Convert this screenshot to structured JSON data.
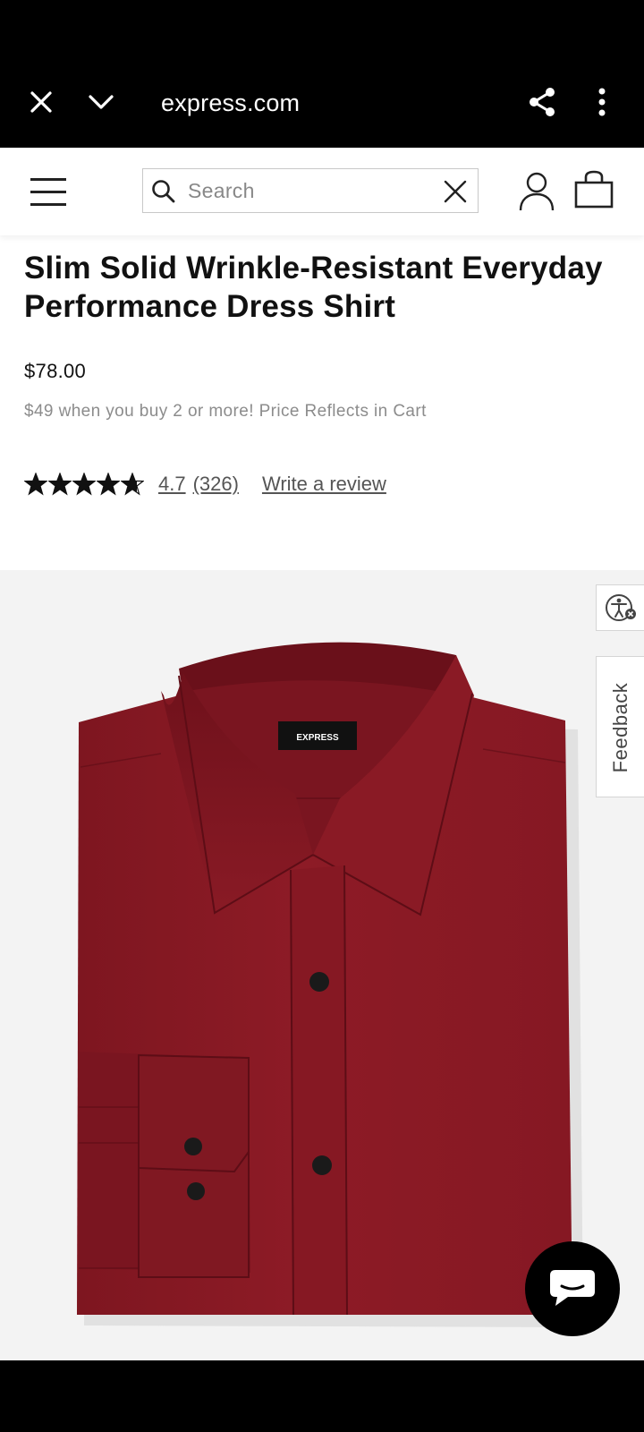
{
  "browser": {
    "url": "express.com",
    "icons": [
      "close-icon",
      "chevron-down-icon",
      "share-icon",
      "more-vertical-icon"
    ]
  },
  "header": {
    "search_placeholder": "Search",
    "icons": [
      "menu-icon",
      "search-icon",
      "clear-icon",
      "account-icon",
      "shopping-bag-icon"
    ]
  },
  "product": {
    "title": "Slim Solid Wrinkle-Resistant Everyday Performance Dress Shirt",
    "price": "$78.00",
    "promo": "$49 when you buy 2 or more! Price Reflects in Cart",
    "rating_stars": 4.7,
    "rating_value": "4.7",
    "review_count": "(326)",
    "write_review": "Write a review",
    "label_text": "EXPRESS",
    "shirt_color": "#8b1a24"
  },
  "side_tabs": {
    "feedback": "Feedback",
    "icons": [
      "accessibility-icon"
    ]
  },
  "chat": {
    "icons": [
      "chat-bubble-icon"
    ]
  },
  "colors": {
    "browser_bar": "#000000",
    "text_primary": "#111111",
    "text_muted": "#8c8c8c",
    "image_bg": "#f3f3f3"
  }
}
